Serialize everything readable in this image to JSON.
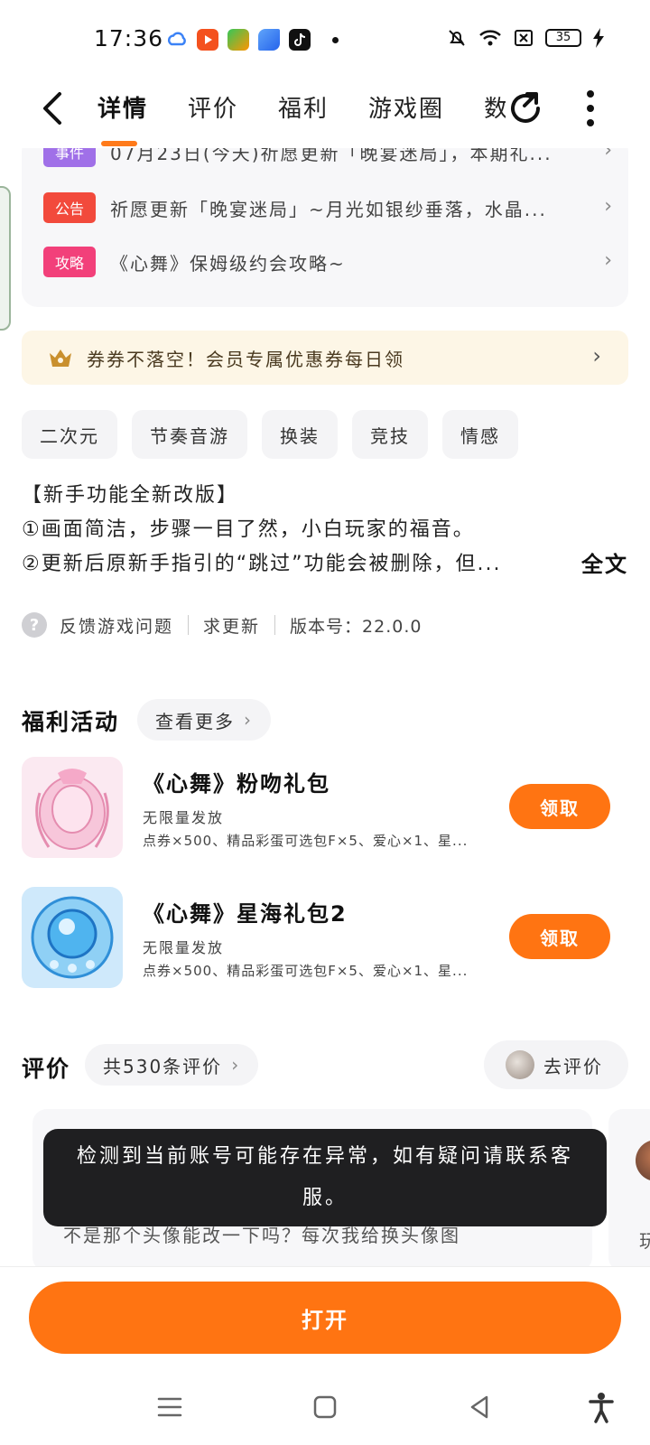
{
  "status_bar": {
    "time": "17:36",
    "battery": "35",
    "icons": [
      "cloud-icon",
      "video-app-icon",
      "tv-app-icon",
      "feather-app-icon",
      "tiktok-icon",
      "mute-icon",
      "wifi-icon",
      "sim-off-icon",
      "charging-icon"
    ]
  },
  "nav": {
    "tabs": [
      "详情",
      "评价",
      "福利",
      "游戏圈",
      "数"
    ],
    "active_tab": "详情"
  },
  "news": [
    {
      "tag": "事件",
      "tag_color": "#a070e8",
      "text": "07月23日(今天)祈愿更新「晚宴迷局」，本期礼..."
    },
    {
      "tag": "公告",
      "tag_color": "#f24a3c",
      "text": "祈愿更新「晚宴迷局」~月光如银纱垂落，水晶..."
    },
    {
      "tag": "攻略",
      "tag_color": "#f2407a",
      "text": "《心舞》保姆级约会攻略~"
    }
  ],
  "member_banner": "券券不落空！会员专属优惠券每日领",
  "genres": [
    "二次元",
    "节奏音游",
    "换装",
    "竞技",
    "情感"
  ],
  "description": {
    "line1": "【新手功能全新改版】",
    "line2": "①画面简洁，步骤一目了然，小白玩家的福音。",
    "line3": "②更新后原新手指引的“跳过”功能会被删除，但...",
    "full_text": "全文"
  },
  "feedback": {
    "report": "反馈游戏问题",
    "request_update": "求更新",
    "version": "版本号：22.0.0"
  },
  "welfare": {
    "title": "福利活动",
    "more": "查看更多",
    "gifts": [
      {
        "title": "《心舞》粉吻礼包",
        "sub": "无限量发放",
        "desc": "点券×500、精品彩蛋可选包F×5、爱心×1、星...",
        "button": "领取"
      },
      {
        "title": "《心舞》星海礼包2",
        "sub": "无限量发放",
        "desc": "点券×500、精品彩蛋可选包F×5、爱心×1、星...",
        "button": "领取"
      }
    ]
  },
  "reviews": {
    "title": "评价",
    "count": "共530条评价",
    "go_review": "去评价",
    "snippet": "不是那个头像能改一下吗？每次我给换头像图",
    "peek_char": "玩"
  },
  "toast": "检测到当前账号可能存在异常，如有疑问请联系客服。",
  "open_button": "打开",
  "accent_color": "#ff7412"
}
